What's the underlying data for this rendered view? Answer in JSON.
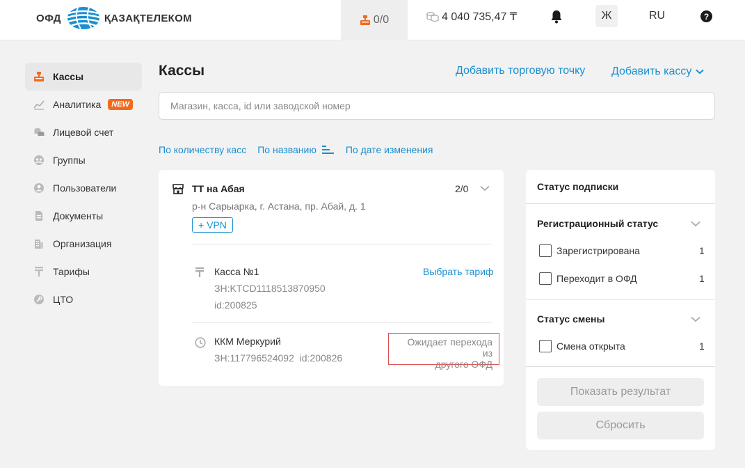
{
  "header": {
    "logo_ofd": "ОФД",
    "logo_name": "ҚАЗАҚТЕЛЕКОМ",
    "kkm_counter": "0/0",
    "balance": "4 040 735,47 ₸",
    "user_initial": "Ж",
    "language": "RU",
    "help": "?"
  },
  "sidebar": {
    "items": [
      {
        "label": "Кассы",
        "icon": "cash-register-icon",
        "active": true
      },
      {
        "label": "Аналитика",
        "icon": "chart-icon",
        "badge": "NEW"
      },
      {
        "label": "Лицевой счет",
        "icon": "coins-icon"
      },
      {
        "label": "Группы",
        "icon": "groups-icon"
      },
      {
        "label": "Пользователи",
        "icon": "user-icon"
      },
      {
        "label": "Документы",
        "icon": "document-icon"
      },
      {
        "label": "Организация",
        "icon": "building-icon"
      },
      {
        "label": "Тарифы",
        "icon": "tariff-icon"
      },
      {
        "label": "ЦТО",
        "icon": "wrench-icon"
      }
    ]
  },
  "main": {
    "title": "Кассы",
    "add_point": "Добавить торговую точку",
    "add_kassa": "Добавить кассу",
    "search_placeholder": "Магазин, касса, id или заводской номер",
    "sort": {
      "by_count": "По количеству касс",
      "by_name": "По названию",
      "by_date": "По дате изменения"
    },
    "store": {
      "name": "ТТ на Абая",
      "count": "2/0",
      "address": "р-н Сарыарка, г. Астана, пр. Абай, д. 1",
      "vpn": "+ VPN",
      "kassas": [
        {
          "name": "Касса №1",
          "action": "Выбрать тариф",
          "zn": "ЗН:KTCD1118513870950",
          "id": "id:200825"
        },
        {
          "name": "ККМ Меркурий",
          "zn": "ЗН:117796524092",
          "id": "id:200826",
          "status_line1": "Ожидает перехода из",
          "status_line2": "другого ОФД"
        }
      ]
    }
  },
  "filter": {
    "title": "Статус подписки",
    "reg_title": "Регистрационный статус",
    "reg_items": [
      {
        "label": "Зарегистрирована",
        "count": "1"
      },
      {
        "label": "Переходит в ОФД",
        "count": "1"
      }
    ],
    "shift_title": "Статус смены",
    "shift_items": [
      {
        "label": "Смена открыта",
        "count": "1"
      }
    ],
    "show_result": "Показать результат",
    "reset": "Сбросить"
  },
  "colors": {
    "accent_blue": "#1a8fd0",
    "brand_orange": "#f26a1b",
    "warning_border": "#e05050"
  }
}
